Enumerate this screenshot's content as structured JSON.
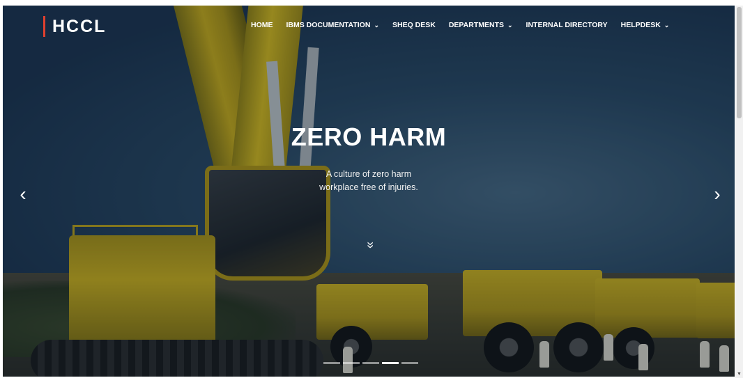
{
  "brand": {
    "logo_text": "HCCL",
    "accent_color": "#e0402f"
  },
  "nav": {
    "items": [
      {
        "label": "HOME",
        "has_dropdown": false
      },
      {
        "label": "IBMS DOCUMENTATION",
        "has_dropdown": true
      },
      {
        "label": "SHEQ DESK",
        "has_dropdown": false
      },
      {
        "label": "DEPARTMENTS",
        "has_dropdown": true
      },
      {
        "label": "INTERNAL DIRECTORY",
        "has_dropdown": false
      },
      {
        "label": "HELPDESK",
        "has_dropdown": true
      }
    ],
    "dropdown_icon": "⌄"
  },
  "hero": {
    "title": "ZERO HARM",
    "subtitle_line1": "A culture of zero harm",
    "subtitle_line2": "workplace free of injuries.",
    "scroll_icon": "»",
    "prev_icon": "‹",
    "next_icon": "›"
  },
  "carousel": {
    "slide_count": 5,
    "active_index": 3
  },
  "scrollbar": {
    "down_icon": "▼"
  }
}
